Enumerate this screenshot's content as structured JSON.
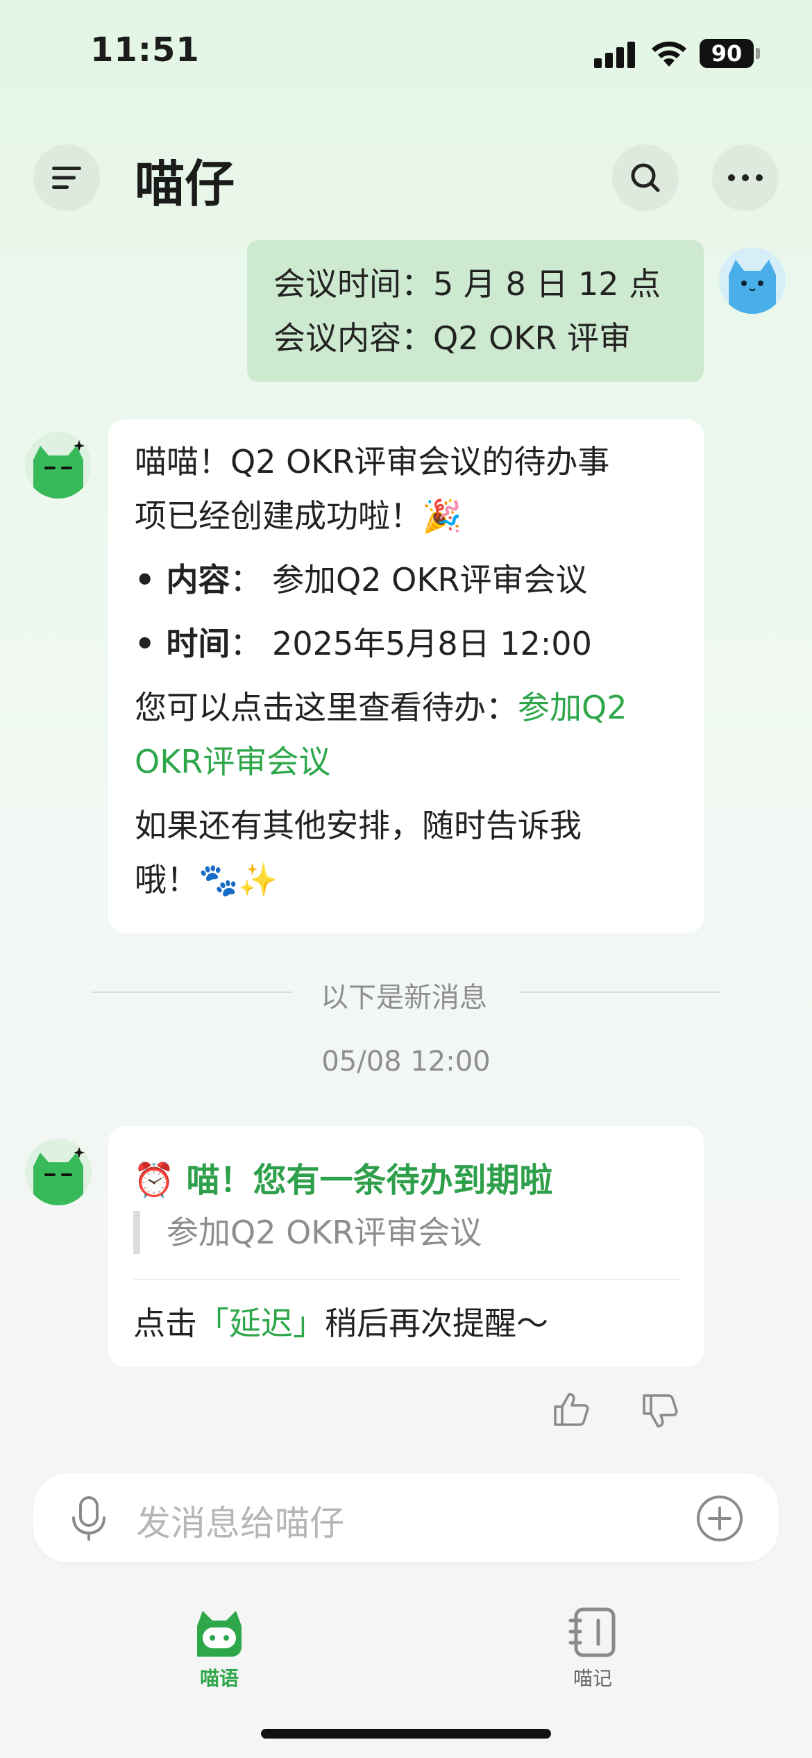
{
  "status_bar": {
    "time": "11:51",
    "battery": "90"
  },
  "header": {
    "title": "喵仔"
  },
  "user_message": {
    "line1": "会议时间：5 月 8 日 12 点",
    "line2": "会议内容：Q2 OKR 评审"
  },
  "bot_message_1": {
    "line1": "喵喵！Q2 OKR评审会议的待办事",
    "line2": "项已经创建成功啦！🎉",
    "content_label": "内容",
    "content_value": "参加Q2 OKR评审会议",
    "time_label": "时间",
    "time_value": "2025年5月8日 12:00",
    "view_prefix": "您可以点击这里查看待办：",
    "view_link_part1": "参加Q2",
    "view_link_part2": "OKR评审会议",
    "closing_line1": "如果还有其他安排，随时告诉我",
    "closing_line2": "哦！🐾✨"
  },
  "divider": {
    "label": "以下是新消息"
  },
  "timestamp": "05/08 12:00",
  "reminder": {
    "icon": "⏰",
    "title": "喵！您有一条待办到期啦",
    "todo": "参加Q2 OKR评审会议",
    "hint_prefix": "点击",
    "hint_link": "「延迟」",
    "hint_suffix": "稍后再次提醒～"
  },
  "input": {
    "placeholder": "发消息给喵仔"
  },
  "tabs": [
    {
      "label": "喵语",
      "active": true
    },
    {
      "label": "喵记",
      "active": false
    }
  ],
  "colors": {
    "accent_green": "#2ea64a",
    "user_bubble": "#cde9cf"
  }
}
